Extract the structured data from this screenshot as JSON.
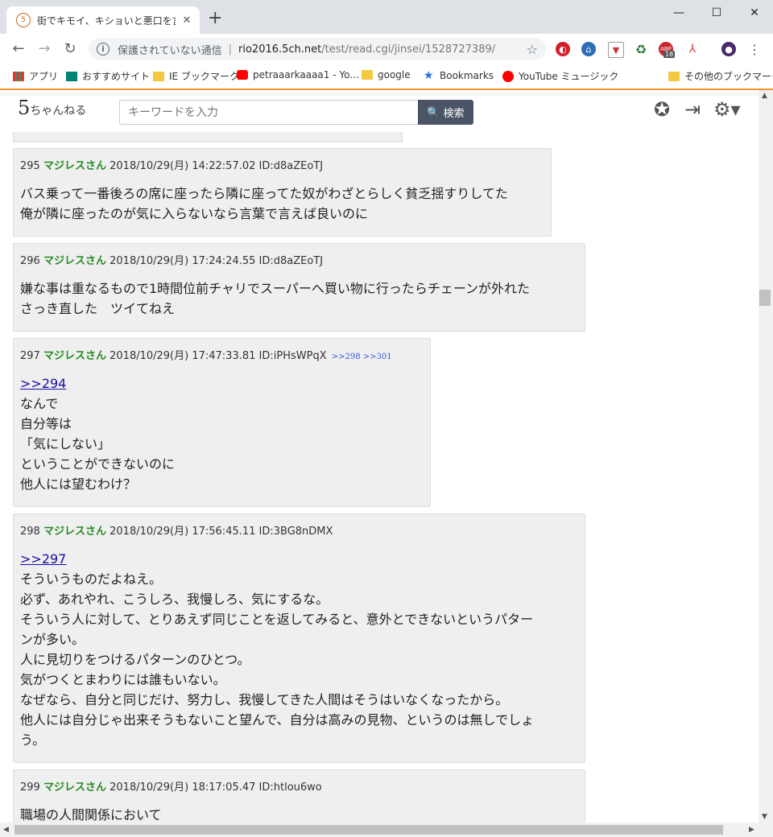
{
  "browser": {
    "tab_title": "街でキモイ、キショいと悪口を言われる",
    "new_tab": "+",
    "insecure_label": "保護されていない通信",
    "url_host": "rio2016.5ch.net",
    "url_path": "/test/read.cgi/jinsei/1528727389/",
    "badge": "18",
    "bookmarks": [
      {
        "label": "アプリ",
        "icon": "apps-grid-icon"
      },
      {
        "label": "おすすめサイト",
        "icon": "bing-icon"
      },
      {
        "label": "IE ブックマーク",
        "icon": "folder-icon"
      },
      {
        "label": "petraaarkaaaa1 - Yo...",
        "icon": "youtube-icon"
      },
      {
        "label": "google",
        "icon": "folder-icon"
      },
      {
        "label": "Bookmarks",
        "icon": "star-icon"
      },
      {
        "label": "YouTube ミュージック",
        "icon": "youtube-music-icon"
      },
      {
        "label": "その他のブックマーク",
        "icon": "folder-icon"
      }
    ]
  },
  "site": {
    "logo_main": "5",
    "logo_sub": "ちゃんねる",
    "search_placeholder": "キーワードを入力",
    "search_button": "検索"
  },
  "posts": [
    {
      "num": "295",
      "name": "マジレスさん",
      "date": "2018/10/29(月) 14:22:57.02",
      "id": "ID:d8aZEoTJ",
      "replies": "",
      "anchor": "",
      "body": "バス乗って一番後ろの席に座ったら隣に座ってた奴がわざとらしく貧乏揺すりしてた\n俺が隣に座ったのが気に入らないなら言葉で言えば良いのに"
    },
    {
      "num": "296",
      "name": "マジレスさん",
      "date": "2018/10/29(月) 17:24:24.55",
      "id": "ID:d8aZEoTJ",
      "replies": "",
      "anchor": "",
      "body": "嫌な事は重なるもので1時間位前チャリでスーパーへ買い物に行ったらチェーンが外れた\nさっき直した　ツイてねえ"
    },
    {
      "num": "297",
      "name": "マジレスさん",
      "date": "2018/10/29(月) 17:47:33.81",
      "id": "ID:iPHsWPqX",
      "replies": ">>298 >>301",
      "anchor": ">>294",
      "body": "なんで\n自分等は\n「気にしない」\nということができないのに\n他人には望むわけ？"
    },
    {
      "num": "298",
      "name": "マジレスさん",
      "date": "2018/10/29(月) 17:56:45.11",
      "id": "ID:3BG8nDMX",
      "replies": "",
      "anchor": ">>297",
      "body": "そういうものだよねえ。\n必ず、あれやれ、こうしろ、我慢しろ、気にするな。\nそういう人に対して、とりあえず同じことを返してみると、意外とできないというパター\nンが多い。\n人に見切りをつけるパターンのひとつ。\n気がつくとまわりには誰もいない。\nなぜなら、自分と同じだけ、努力し、我慢してきた人間はそうはいなくなったから。\n他人には自分じゃ出来そうもないこと望んで、自分は高みの見物、というのは無しでしょ\nう。"
    },
    {
      "num": "299",
      "name": "マジレスさん",
      "date": "2018/10/29(月) 18:17:05.47",
      "id": "ID:htlou6wo",
      "replies": "",
      "anchor": "",
      "body": "職場の人間関係において"
    }
  ]
}
